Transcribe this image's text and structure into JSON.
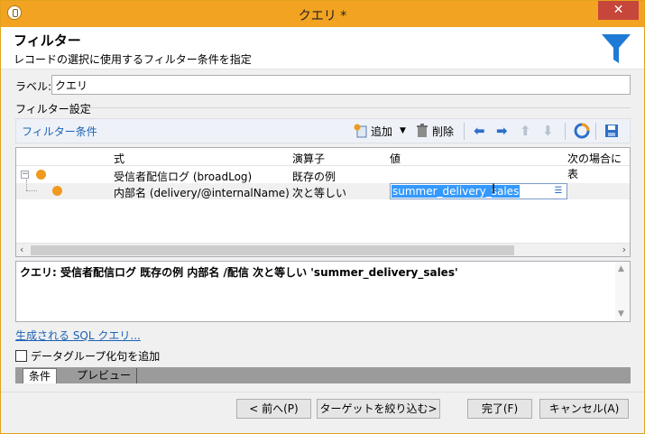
{
  "window": {
    "title": "クエリ *",
    "close_label": "✕"
  },
  "header": {
    "title": "フィルター",
    "subtitle": "レコードの選択に使用するフィルター条件を指定"
  },
  "label": {
    "caption": "ラベル:",
    "value": "クエリ"
  },
  "filter_settings": {
    "caption": "フィルター設定"
  },
  "toolbar": {
    "title": "フィルター条件",
    "add_label": "追加",
    "delete_label": "削除"
  },
  "grid": {
    "columns": [
      "式",
      "演算子",
      "値",
      "次の場合に表"
    ],
    "rows": [
      {
        "expression": "受信者配信ログ (broadLog)",
        "operator": "既存の例",
        "value": ""
      },
      {
        "expression": "内部名 (delivery/@internalName)",
        "operator": "次と等しい",
        "value": "summer_delivery_sales"
      }
    ]
  },
  "query_text": "クエリ: 受信者配信ログ 既存の例 内部名 /配信 次と等しい 'summer_delivery_sales'",
  "sql_link": "生成される SQL クエリ...",
  "add_data_grouping": {
    "label": "データグループ化句を追加",
    "checked": false
  },
  "tabs": [
    "条件",
    "プレビュー"
  ],
  "buttons": {
    "prev": "< 前へ(P)",
    "narrow": "ターゲットを絞り込む>",
    "finish": "完了(F)",
    "cancel": "キャンセル(A)"
  },
  "colors": {
    "titlebar": "#f1a321",
    "accent_blue": "#1b62b5",
    "dot_orange": "#f09a1e",
    "selection": "#3399ff"
  },
  "icons": [
    "app-icon",
    "close-icon",
    "funnel-icon",
    "add-icon",
    "dropdown-icon",
    "trash-icon",
    "arrow-left-icon",
    "arrow-right-icon",
    "arrow-up-icon",
    "arrow-down-icon",
    "distribution-icon",
    "save-icon",
    "expander-icon",
    "expression-editor-icon"
  ]
}
